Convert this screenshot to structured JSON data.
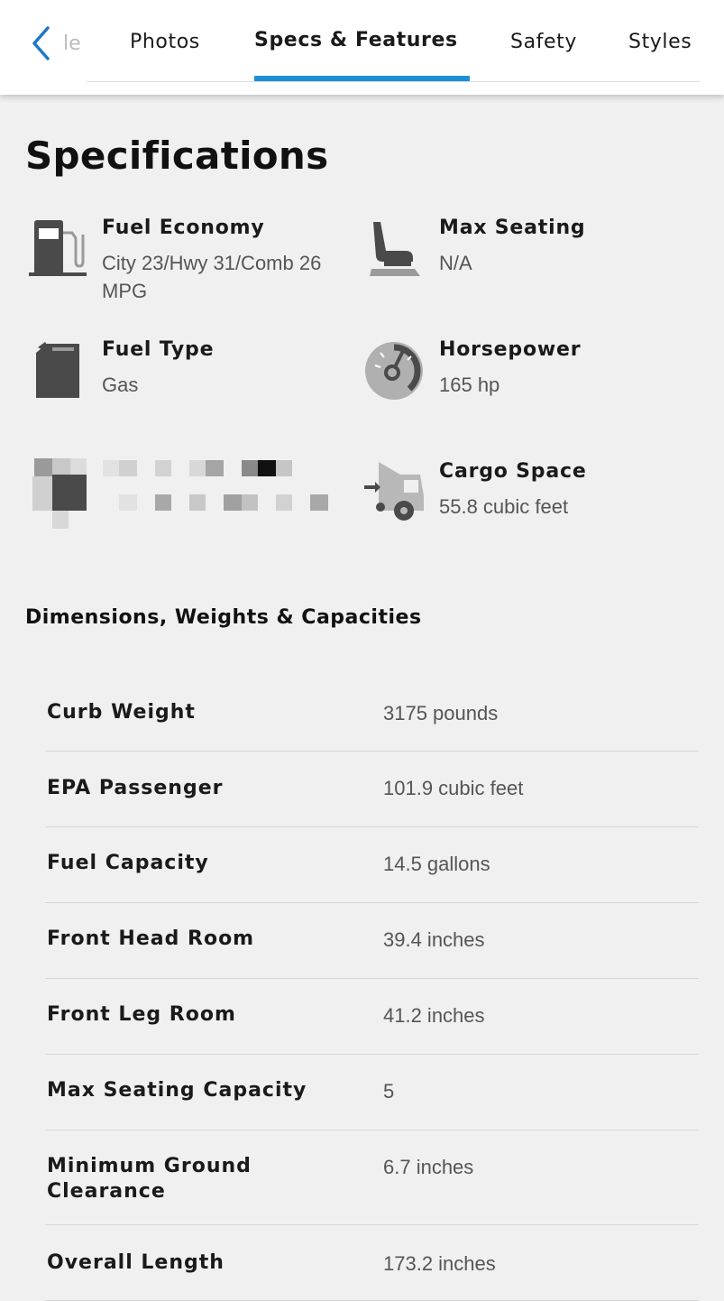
{
  "nav": {
    "back_label": "back",
    "cut_tab": "le",
    "tabs": [
      {
        "label": "Photos"
      },
      {
        "label": "Specs & Features"
      },
      {
        "label": "Safety"
      },
      {
        "label": "Styles"
      }
    ],
    "active_tab_index": 1,
    "accent_color": "#1e8fd6"
  },
  "specifications": {
    "title": "Specifications",
    "items": [
      {
        "label": "Fuel Economy",
        "value": "City 23/Hwy 31/Comb 26 MPG",
        "icon": "fuel-pump-icon"
      },
      {
        "label": "Max Seating",
        "value": "N/A",
        "icon": "seat-icon"
      },
      {
        "label": "Fuel Type",
        "value": "Gas",
        "icon": "fuel-can-icon"
      },
      {
        "label": "Horsepower",
        "value": "165 hp",
        "icon": "speedometer-icon"
      },
      {
        "label": "Cargo Space",
        "value": "55.8 cubic feet",
        "icon": "cargo-car-icon"
      }
    ],
    "redacted_icon": "pixelated-icon"
  },
  "dimensions": {
    "title": "Dimensions, Weights & Capacities",
    "rows": [
      {
        "key": "Curb Weight",
        "value": "3175 pounds"
      },
      {
        "key": "EPA Passenger",
        "value": "101.9 cubic feet"
      },
      {
        "key": "Fuel Capacity",
        "value": "14.5 gallons"
      },
      {
        "key": "Front Head Room",
        "value": "39.4 inches"
      },
      {
        "key": "Front Leg Room",
        "value": "41.2 inches"
      },
      {
        "key": "Max Seating Capacity",
        "value": "5"
      },
      {
        "key": "Minimum Ground Clearance",
        "value": "6.7 inches"
      },
      {
        "key": "Overall Length",
        "value": "173.2 inches"
      }
    ]
  }
}
